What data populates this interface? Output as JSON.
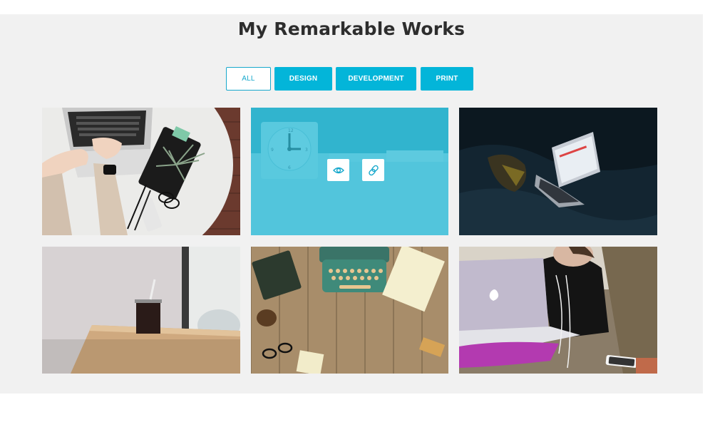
{
  "portfolio": {
    "title": "My Remarkable Works",
    "filters": [
      {
        "label": "ALL",
        "active": true
      },
      {
        "label": "DESIGN",
        "active": false
      },
      {
        "label": "DEVELOPMENT",
        "active": false
      },
      {
        "label": "PRINT",
        "active": false
      }
    ],
    "accent_color": "#03b5d9",
    "overlay": {
      "view_icon": "eye-icon",
      "link_icon": "link-icon"
    }
  }
}
